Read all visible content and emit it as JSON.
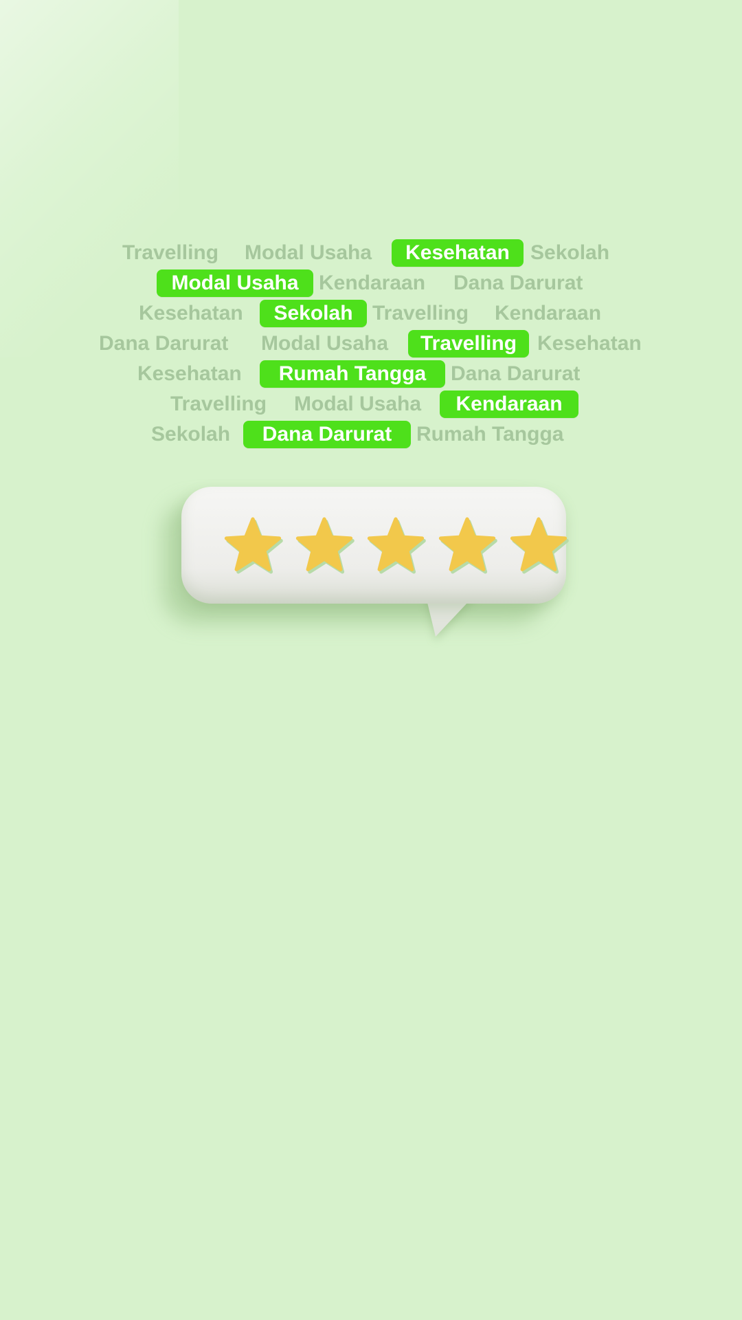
{
  "tag_rows": [
    [
      {
        "label": "Travelling",
        "highlighted": false
      },
      {
        "label": "Modal Usaha",
        "highlighted": false
      },
      {
        "label": "Kesehatan",
        "highlighted": true
      },
      {
        "label": "Sekolah",
        "highlighted": false
      }
    ],
    [
      {
        "label": "Modal Usaha",
        "highlighted": true
      },
      {
        "label": "Kendaraan",
        "highlighted": false
      },
      {
        "label": "Dana Darurat",
        "highlighted": false
      }
    ],
    [
      {
        "label": "Kesehatan",
        "highlighted": false
      },
      {
        "label": "Sekolah",
        "highlighted": true
      },
      {
        "label": "Travelling",
        "highlighted": false
      },
      {
        "label": "Kendaraan",
        "highlighted": false
      }
    ],
    [
      {
        "label": "Dana Darurat",
        "highlighted": false
      },
      {
        "label": "Modal Usaha",
        "highlighted": false
      },
      {
        "label": "Travelling",
        "highlighted": true
      },
      {
        "label": "Kesehatan",
        "highlighted": false
      }
    ],
    [
      {
        "label": "Kesehatan",
        "highlighted": false
      },
      {
        "label": "Rumah Tangga",
        "highlighted": true
      },
      {
        "label": "Dana Darurat",
        "highlighted": false
      }
    ],
    [
      {
        "label": "Travelling",
        "highlighted": false
      },
      {
        "label": "Modal Usaha",
        "highlighted": false
      },
      {
        "label": "Kendaraan",
        "highlighted": true
      }
    ],
    [
      {
        "label": "Sekolah",
        "highlighted": false
      },
      {
        "label": "Dana Darurat",
        "highlighted": true
      },
      {
        "label": "Rumah Tangga",
        "highlighted": false
      }
    ]
  ],
  "rating": {
    "stars": 5,
    "max_stars": 5,
    "icon": "star-icon"
  },
  "colors": {
    "background": "#d7f2cc",
    "tag_text": "#a6c79d",
    "highlight_bg": "#4ee01b",
    "highlight_text": "#ffffff",
    "star": "#f2c84b",
    "bubble": "#f3f3f1"
  }
}
